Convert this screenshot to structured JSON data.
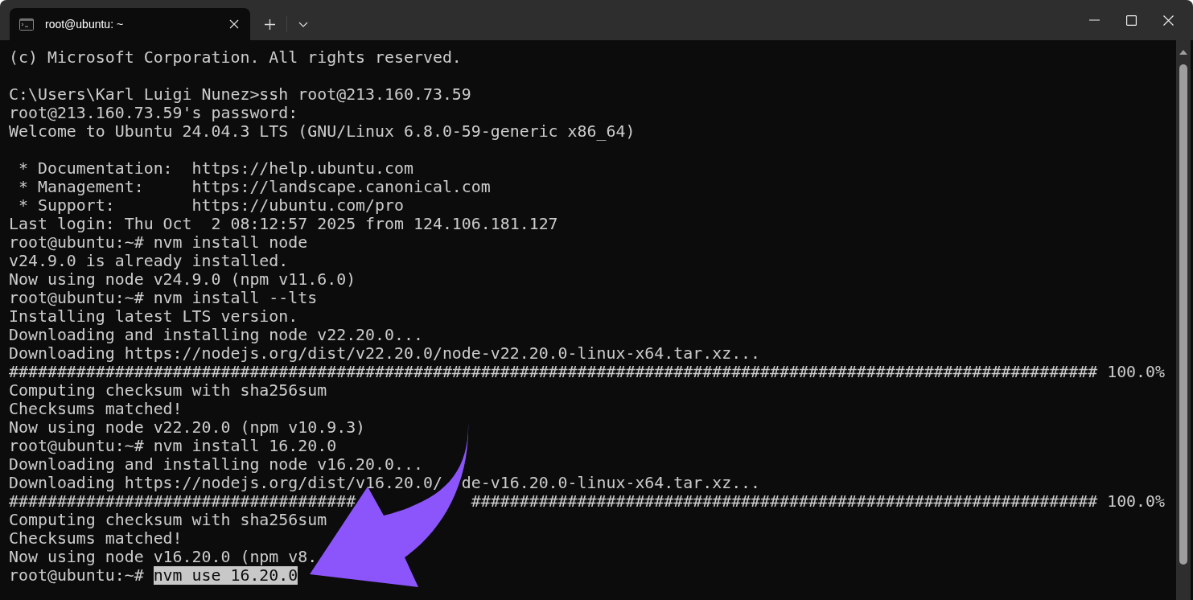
{
  "window": {
    "tabs": [
      {
        "title": "root@ubuntu: ~",
        "selected": true
      }
    ]
  },
  "terminal": {
    "lines": [
      {
        "text": "(c) Microsoft Corporation. All rights reserved.",
        "blank_after": true
      },
      {
        "text": "C:\\Users\\Karl Luigi Nunez>ssh root@213.160.73.59"
      },
      {
        "text": "root@213.160.73.59's password:"
      },
      {
        "text": "Welcome to Ubuntu 24.04.3 LTS (GNU/Linux 6.8.0-59-generic x86_64)",
        "blank_after": true
      },
      {
        "text": " * Documentation:  https://help.ubuntu.com"
      },
      {
        "text": " * Management:     https://landscape.canonical.com"
      },
      {
        "text": " * Support:        https://ubuntu.com/pro"
      },
      {
        "text": "Last login: Thu Oct  2 08:12:57 2025 from 124.106.181.127"
      },
      {
        "text": "root@ubuntu:~# nvm install node"
      },
      {
        "text": "v24.9.0 is already installed."
      },
      {
        "text": "Now using node v24.9.0 (npm v11.6.0)"
      },
      {
        "text": "root@ubuntu:~# nvm install --lts"
      },
      {
        "text": "Installing latest LTS version."
      },
      {
        "text": "Downloading and installing node v22.20.0..."
      },
      {
        "text": "Downloading https://nodejs.org/dist/v22.20.0/node-v22.20.0-linux-x64.tar.xz..."
      },
      {
        "text": "################################################################################################################# 100.0%"
      },
      {
        "text": "Computing checksum with sha256sum"
      },
      {
        "text": "Checksums matched!"
      },
      {
        "text": "Now using node v22.20.0 (npm v10.9.3)"
      },
      {
        "text": "root@ubuntu:~# nvm install 16.20.0"
      },
      {
        "text": "Downloading and installing node v16.20.0..."
      },
      {
        "text": "Downloading https://nodejs.org/dist/v16.20.0/  de-v16.20.0-linux-x64.tar.xz..."
      },
      {
        "text": "####################################            ################################################################# 100.0%"
      },
      {
        "text": "Computing checksum with sha256sum"
      },
      {
        "text": "Checksums matched!"
      },
      {
        "text": "Now using node v16.20.0 (npm v8."
      },
      {
        "text": "root@ubuntu:~# ",
        "selection": "nvm use 16.20.0"
      }
    ]
  }
}
